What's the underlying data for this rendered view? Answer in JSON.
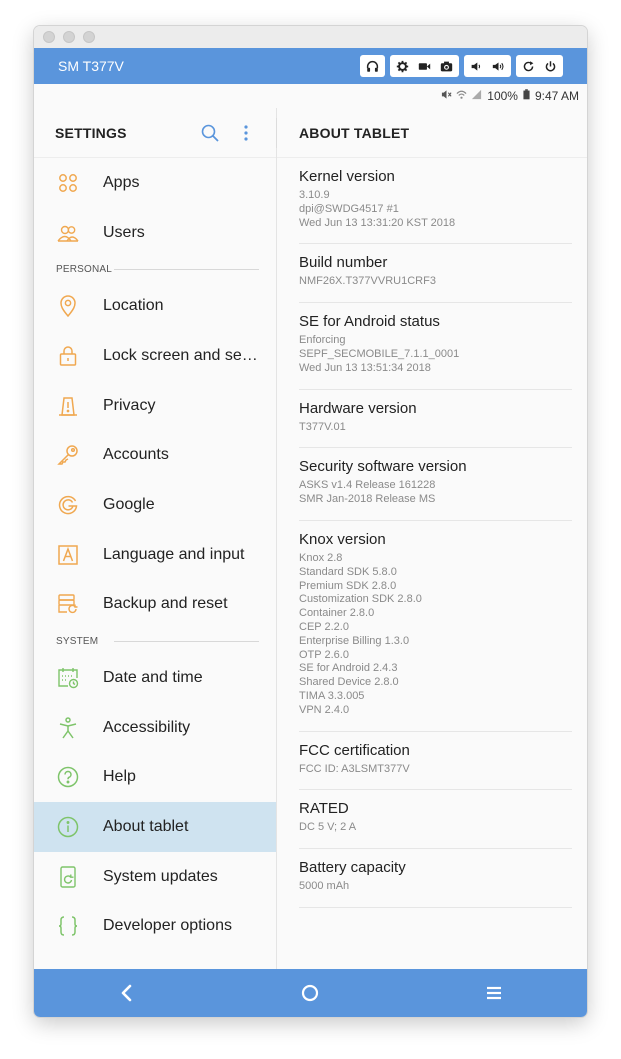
{
  "window": {
    "device_name": "SM T377V",
    "controls": [
      {
        "name": "headphones-icon"
      },
      {
        "name": "gear-icon"
      },
      {
        "name": "video-camera-icon"
      },
      {
        "name": "camera-icon"
      },
      {
        "name": "volume-down-icon"
      },
      {
        "name": "volume-up-icon"
      },
      {
        "name": "rotate-icon"
      },
      {
        "name": "power-icon"
      }
    ]
  },
  "status_bar": {
    "icons": [
      "mute-icon",
      "wifi-icon",
      "signal-icon",
      "battery-icon"
    ],
    "battery": "100%",
    "time": "9:47 AM"
  },
  "settings_pane": {
    "title": "SETTINGS",
    "icons": [
      "search-icon",
      "more-options-icon"
    ],
    "entries": [
      {
        "type": "item",
        "label": "Apps",
        "icon": "apps-icon"
      },
      {
        "type": "item",
        "label": "Users",
        "icon": "users-icon"
      },
      {
        "type": "section",
        "label": "PERSONAL"
      },
      {
        "type": "item",
        "label": "Location",
        "icon": "location-icon"
      },
      {
        "type": "item",
        "label": "Lock screen and se…",
        "icon": "lock-icon"
      },
      {
        "type": "item",
        "label": "Privacy",
        "icon": "privacy-icon"
      },
      {
        "type": "item",
        "label": "Accounts",
        "icon": "key-icon"
      },
      {
        "type": "item",
        "label": "Google",
        "icon": "google-icon"
      },
      {
        "type": "item",
        "label": "Language and input",
        "icon": "language-icon"
      },
      {
        "type": "item",
        "label": "Backup and reset",
        "icon": "backup-icon"
      },
      {
        "type": "section",
        "label": "SYSTEM"
      },
      {
        "type": "item",
        "label": "Date and time",
        "icon": "calendar-clock-icon"
      },
      {
        "type": "item",
        "label": "Accessibility",
        "icon": "accessibility-icon"
      },
      {
        "type": "item",
        "label": "Help",
        "icon": "help-icon"
      },
      {
        "type": "item",
        "label": "About tablet",
        "icon": "info-icon",
        "active": true
      },
      {
        "type": "item",
        "label": "System updates",
        "icon": "system-update-icon"
      },
      {
        "type": "item",
        "label": "Developer options",
        "icon": "developer-icon"
      }
    ]
  },
  "about_pane": {
    "title": "ABOUT TABLET",
    "items": [
      {
        "title": "Kernel version",
        "lines": [
          "3.10.9",
          "dpi@SWDG4517 #1",
          "Wed Jun 13 13:31:20 KST 2018"
        ]
      },
      {
        "title": "Build number",
        "lines": [
          "NMF26X.T377VVRU1CRF3"
        ]
      },
      {
        "title": "SE for Android status",
        "lines": [
          "Enforcing",
          "SEPF_SECMOBILE_7.1.1_0001",
          "Wed Jun 13 13:51:34 2018"
        ]
      },
      {
        "title": "Hardware version",
        "lines": [
          "T377V.01"
        ]
      },
      {
        "title": "Security software version",
        "lines": [
          "ASKS v1.4 Release 161228",
          "SMR Jan-2018 Release MS"
        ]
      },
      {
        "title": "Knox version",
        "lines": [
          "Knox 2.8",
          "Standard SDK 5.8.0",
          "Premium SDK 2.8.0",
          "Customization SDK 2.8.0",
          "Container 2.8.0",
          "CEP 2.2.0",
          "Enterprise Billing 1.3.0",
          "OTP 2.6.0",
          "SE for Android 2.4.3",
          "Shared Device 2.8.0",
          "TIMA 3.3.005",
          "VPN 2.4.0"
        ]
      },
      {
        "title": "FCC certification",
        "lines": [
          "FCC ID: A3LSMT377V"
        ]
      },
      {
        "title": "RATED",
        "lines": [
          "DC 5 V; 2 A"
        ]
      },
      {
        "title": "Battery capacity",
        "lines": [
          "5000 mAh"
        ]
      }
    ]
  },
  "nav_bar": {
    "buttons": [
      "back-icon",
      "home-icon",
      "recents-icon"
    ]
  },
  "colors": {
    "accent": "#5a95dc",
    "icon_orange": "#f0a850",
    "icon_green": "#7ec46a",
    "active_row": "#cfe3f0"
  }
}
